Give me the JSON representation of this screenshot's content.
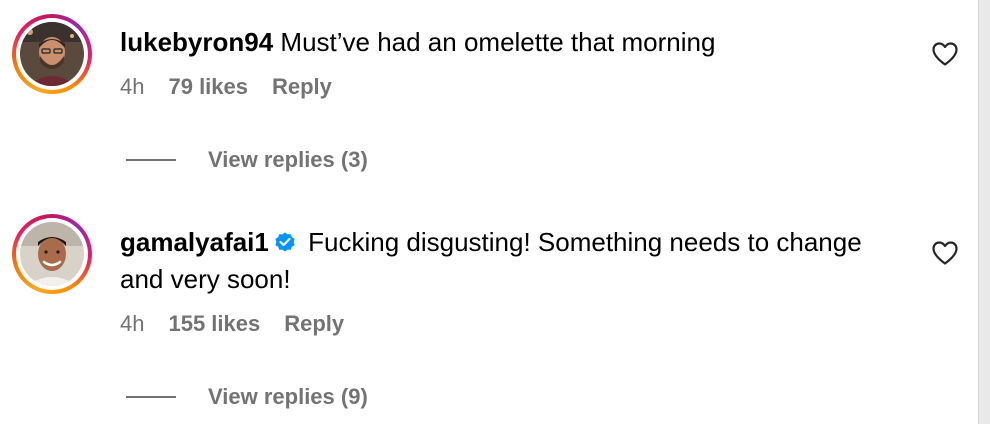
{
  "comments": [
    {
      "username": "lukebyron94",
      "verified": false,
      "text": "Must’ve had an omelette that morning",
      "time": "4h",
      "likes": "79 likes",
      "reply_label": "Reply",
      "view_replies": "View replies (3)"
    },
    {
      "username": "gamalyafai1",
      "verified": true,
      "text": "Fucking disgusting! Something needs to change and very soon!",
      "time": "4h",
      "likes": "155 likes",
      "reply_label": "Reply",
      "view_replies": "View replies (9)"
    }
  ],
  "icons": {
    "like": "heart-outline-icon",
    "verified": "verified-badge-icon"
  },
  "colors": {
    "text": "#000000",
    "secondary": "#737373",
    "verified": "#0095f6",
    "story_ring": [
      "#f9a825",
      "#e91e63",
      "#9c27b0"
    ]
  }
}
